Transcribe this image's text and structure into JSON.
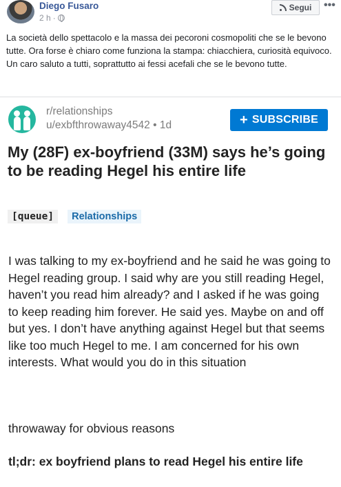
{
  "post": {
    "author": "Diego Fusaro",
    "time": "2 h",
    "separator": "·",
    "follow_label": "Segui",
    "more_label": "•••",
    "text": "La società dello spettacolo e la massa dei pecoroni cosmopoliti che se le bevono tutte. Ora forse è chiaro come funziona la stampa: chiacchiera, curiosità equivoco. Un caro saluto a tutti, soprattutto ai fessi acefali che se le bevono tutte."
  },
  "reddit": {
    "subreddit": "r/relationships",
    "user": "u/exbfthrowaway4542",
    "age": "1d",
    "subscribe_label": "SUBSCRIBE",
    "title": "My (28F) ex-boyfriend (33M) says he’s going to be reading Hegel his entire life",
    "tags": [
      "[queue]",
      "Relationships"
    ],
    "body": "I was talking to my ex-boyfriend and he said he was going to Hegel reading group. I said why are you still reading Hegel, haven’t you read him already? and I asked if he was going to keep reading him forever. He said yes. Maybe on and off but yes. I don’t have anything against Hegel but that seems like too much Hegel to me. I  am concerned for his own interests. What would you do in this situation",
    "note": "throwaway for obvious reasons",
    "tldr": "tl;dr: ex boyfriend plans to read Hegel his entire life"
  },
  "colors": {
    "fb_link": "#385898",
    "reddit_blue": "#0079d3",
    "subreddit_icon": "#25b79f"
  },
  "icons": [
    "avatar",
    "globe-icon",
    "rss-icon",
    "more-icon",
    "relationships-subreddit-icon",
    "plus-icon"
  ]
}
